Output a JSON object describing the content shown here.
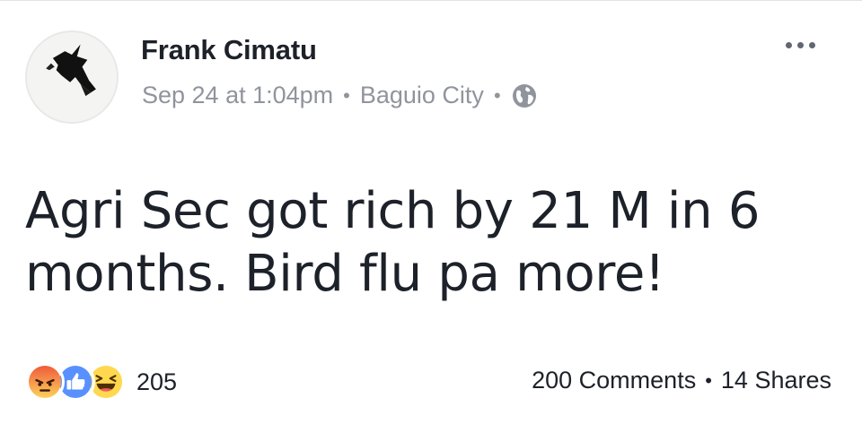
{
  "post": {
    "author": "Frank Cimatu",
    "timestamp": "Sep 24 at 1:04pm",
    "location": "Baguio City",
    "separator": "•",
    "privacy_icon": "globe-icon",
    "options_icon": "more-options-icon",
    "text": "Agri Sec got rich by 21 M in 6 months. Bird flu pa more!",
    "reactions": {
      "types": [
        "angry",
        "like",
        "haha"
      ],
      "count": "205"
    },
    "stats": {
      "comments": "200 Comments",
      "shares": "14 Shares"
    }
  },
  "colors": {
    "text_primary": "#1d2129",
    "text_secondary": "#90949c",
    "like_blue": "#5890ff",
    "angry_orange": "#f05a3a",
    "haha_yellow": "#ffd84f"
  }
}
